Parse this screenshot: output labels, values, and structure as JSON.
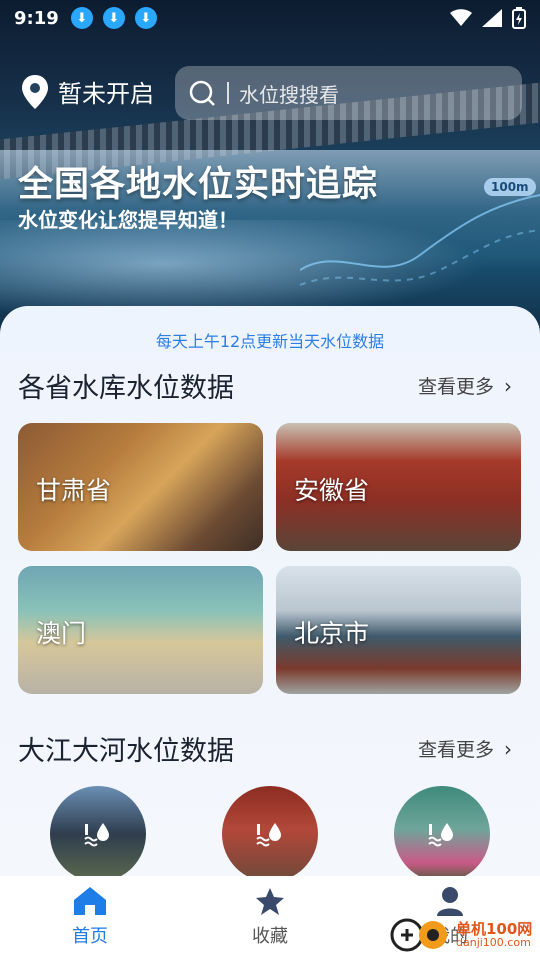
{
  "status_bar": {
    "time": "9:19"
  },
  "header": {
    "location_label": "暂未开启",
    "search_placeholder": "水位搜搜看"
  },
  "hero": {
    "title": "全国各地水位实时追踪",
    "subtitle": "水位变化让您提早知道！",
    "badge": "100m"
  },
  "notice": "每天上午12点更新当天水位数据",
  "province_section": {
    "title": "各省水库水位数据",
    "more_label": "查看更多",
    "items": [
      {
        "label": "甘肃省"
      },
      {
        "label": "安徽省"
      },
      {
        "label": "澳门"
      },
      {
        "label": "北京市"
      }
    ]
  },
  "river_section": {
    "title": "大江大河水位数据",
    "more_label": "查看更多"
  },
  "bottom_nav": {
    "items": [
      {
        "label": "首页",
        "active": true
      },
      {
        "label": "收藏",
        "active": false
      },
      {
        "label": "我的",
        "active": false
      }
    ]
  },
  "watermark": {
    "line1": "单机100网",
    "line2": "danji100.com"
  },
  "colors": {
    "accent": "#1f7de8",
    "notice": "#2e7ee6"
  }
}
